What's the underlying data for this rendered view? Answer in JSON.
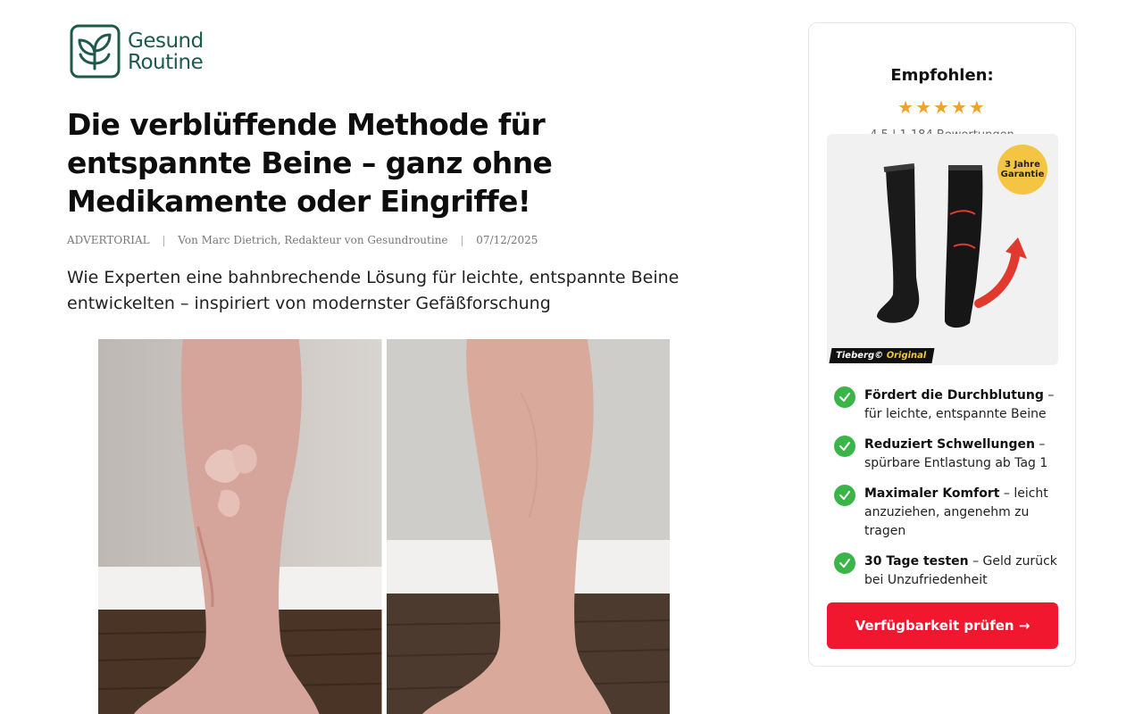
{
  "logo": {
    "line1": "Gesund",
    "line2": "Routine"
  },
  "article": {
    "headline": "Die verblüffende Methode für entspannte Beine – ganz ohne Medikamente oder Eingriffe!",
    "byline": {
      "category": "ADVERTORIAL",
      "author": "Von Marc Dietrich, Redakteur von Gesundroutine",
      "date": "07/12/2025",
      "separator": "|"
    },
    "subheadline": "Wie Experten eine bahnbrechende Lösung für leichte, entspannte Beine entwickelten – inspiriert von modernster Gefäßforschung"
  },
  "sidebar": {
    "title": "Empfohlen:",
    "stars": "★★★★★",
    "rating_text": "4,5 | 1.184 Bewertungen",
    "product": {
      "badge": "3 Jahre Garantie",
      "brand": "Tieberg©",
      "brand_accent": "Original"
    },
    "features": [
      {
        "bold": "Fördert die Durchblutung",
        "rest": " – für leichte, entspannte Beine"
      },
      {
        "bold": "Reduziert Schwellungen",
        "rest": " – spürbare Entlastung ab Tag 1"
      },
      {
        "bold": "Maximaler Komfort",
        "rest": " – leicht anzuziehen, angenehm zu tragen"
      },
      {
        "bold": "30 Tage testen",
        "rest": " – Geld zurück bei Unzufriedenheit"
      }
    ],
    "cta_label": "Verfügbarkeit prüfen →"
  },
  "colors": {
    "brand": "#1e5a4a",
    "star": "#f0a22b",
    "check": "#3bb54a",
    "cta": "#f0172e",
    "badge": "#f4c443"
  }
}
